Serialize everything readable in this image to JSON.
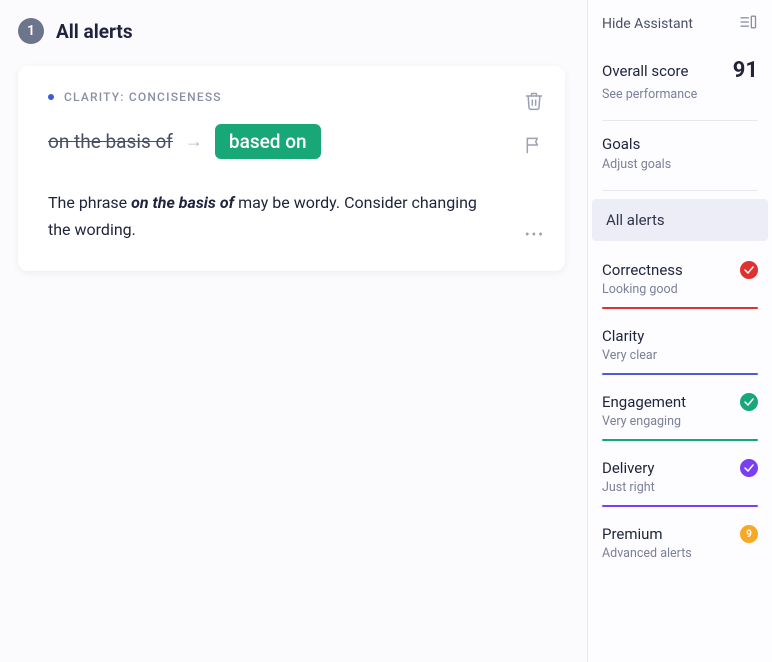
{
  "header": {
    "count": "1",
    "title": "All alerts"
  },
  "card": {
    "category": "CLARITY: CONCISENESS",
    "original": "on the basis of",
    "replacement": "based on",
    "explanation_prefix": "The phrase ",
    "explanation_bold": "on the basis of",
    "explanation_suffix": " may be wordy. Consider changing the wording."
  },
  "sidebar": {
    "hide_label": "Hide Assistant",
    "score": {
      "label": "Overall score",
      "value": "91",
      "sub": "See performance"
    },
    "goals": {
      "label": "Goals",
      "sub": "Adjust goals"
    },
    "all_alerts_label": "All alerts",
    "metrics": {
      "correctness": {
        "name": "Correctness",
        "sub": "Looking good",
        "color": "#e03131"
      },
      "clarity": {
        "name": "Clarity",
        "sub": "Very clear",
        "color": "#4f5bd5"
      },
      "engagement": {
        "name": "Engagement",
        "sub": "Very engaging",
        "color": "#18a878"
      },
      "delivery": {
        "name": "Delivery",
        "sub": "Just right",
        "color": "#7b3ff2"
      },
      "premium": {
        "name": "Premium",
        "sub": "Advanced alerts",
        "badge": "9"
      }
    }
  }
}
